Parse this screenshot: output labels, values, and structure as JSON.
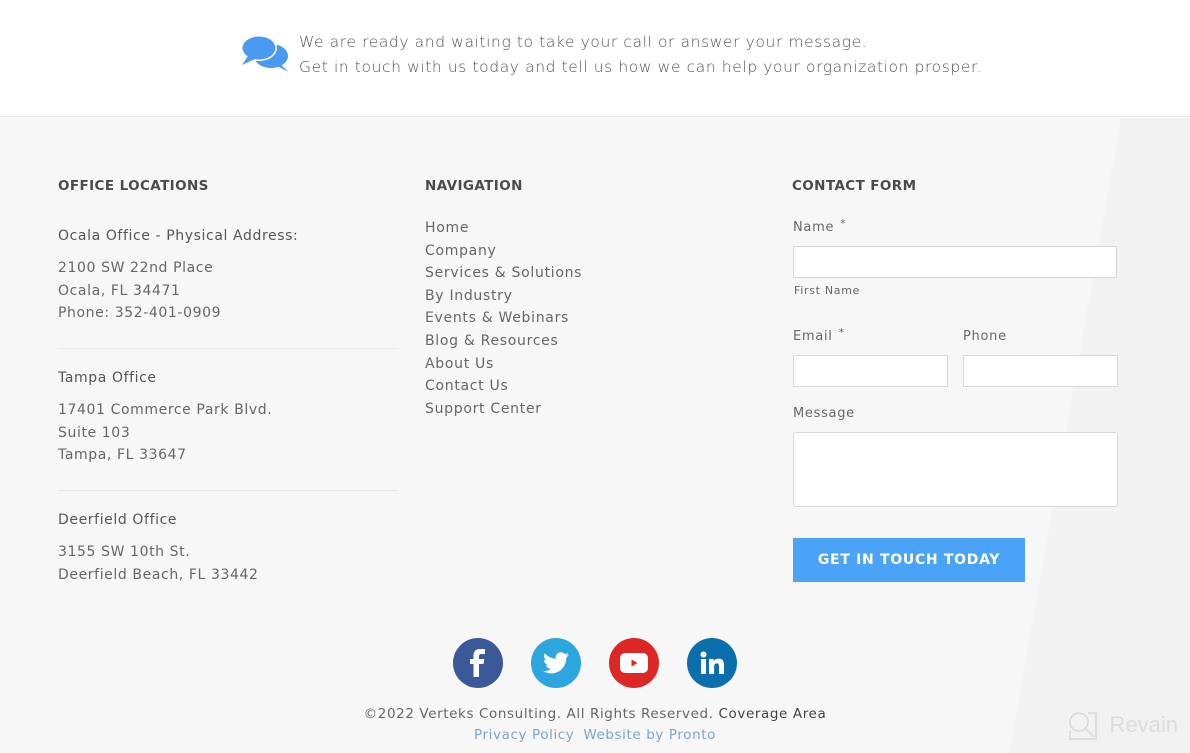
{
  "cta": {
    "icon": "chat-bubbles-icon",
    "line1": "We are ready and waiting to take your call or answer your message.",
    "line2": "Get in touch with us today and tell us how we can help your organization prosper.",
    "icon_color": "#4a9af2"
  },
  "offices": {
    "heading": "OFFICE LOCATIONS",
    "items": [
      {
        "name": "Ocala Office - Physical Address:",
        "lines": [
          "2100 SW 22nd Place",
          "Ocala, FL 34471",
          "Phone: 352-401-0909"
        ]
      },
      {
        "name": "Tampa Office",
        "lines": [
          "17401 Commerce Park Blvd.",
          "Suite 103",
          "Tampa, FL 33647"
        ]
      },
      {
        "name": "Deerfield Office",
        "lines": [
          "3155 SW 10th St.",
          "Deerfield Beach, FL 33442"
        ]
      }
    ]
  },
  "navigation": {
    "heading": "NAVIGATION",
    "items": [
      "Home",
      "Company",
      "Services & Solutions",
      "By Industry",
      "Events & Webinars",
      "Blog & Resources",
      "About Us",
      "Contact Us",
      "Support Center"
    ]
  },
  "contact_form": {
    "heading": "CONTACT FORM",
    "name_label": "Name",
    "name_required": "*",
    "name_value": "",
    "name_sublabel": "First Name",
    "email_label": "Email",
    "email_required": "*",
    "email_value": "",
    "phone_label": "Phone",
    "phone_value": "",
    "message_label": "Message",
    "message_value": "",
    "submit_label": "GET IN TOUCH TODAY",
    "submit_color": "#4aa3f7"
  },
  "social": [
    {
      "name": "facebook",
      "icon": "facebook-icon",
      "color": "#3b5998"
    },
    {
      "name": "twitter",
      "icon": "twitter-icon",
      "color": "#2da6e0"
    },
    {
      "name": "youtube",
      "icon": "youtube-icon",
      "color": "#dd2727"
    },
    {
      "name": "linkedin",
      "icon": "linkedin-icon",
      "color": "#0b6fae"
    }
  ],
  "footer": {
    "copyright": "©2022 Verteks Consulting. All Rights Reserved.",
    "coverage_link": "Coverage Area",
    "privacy_link": "Privacy Policy",
    "credit_link": "Website by Pronto"
  },
  "watermark": {
    "text": "Revain",
    "icon": "revain-logo-icon"
  }
}
